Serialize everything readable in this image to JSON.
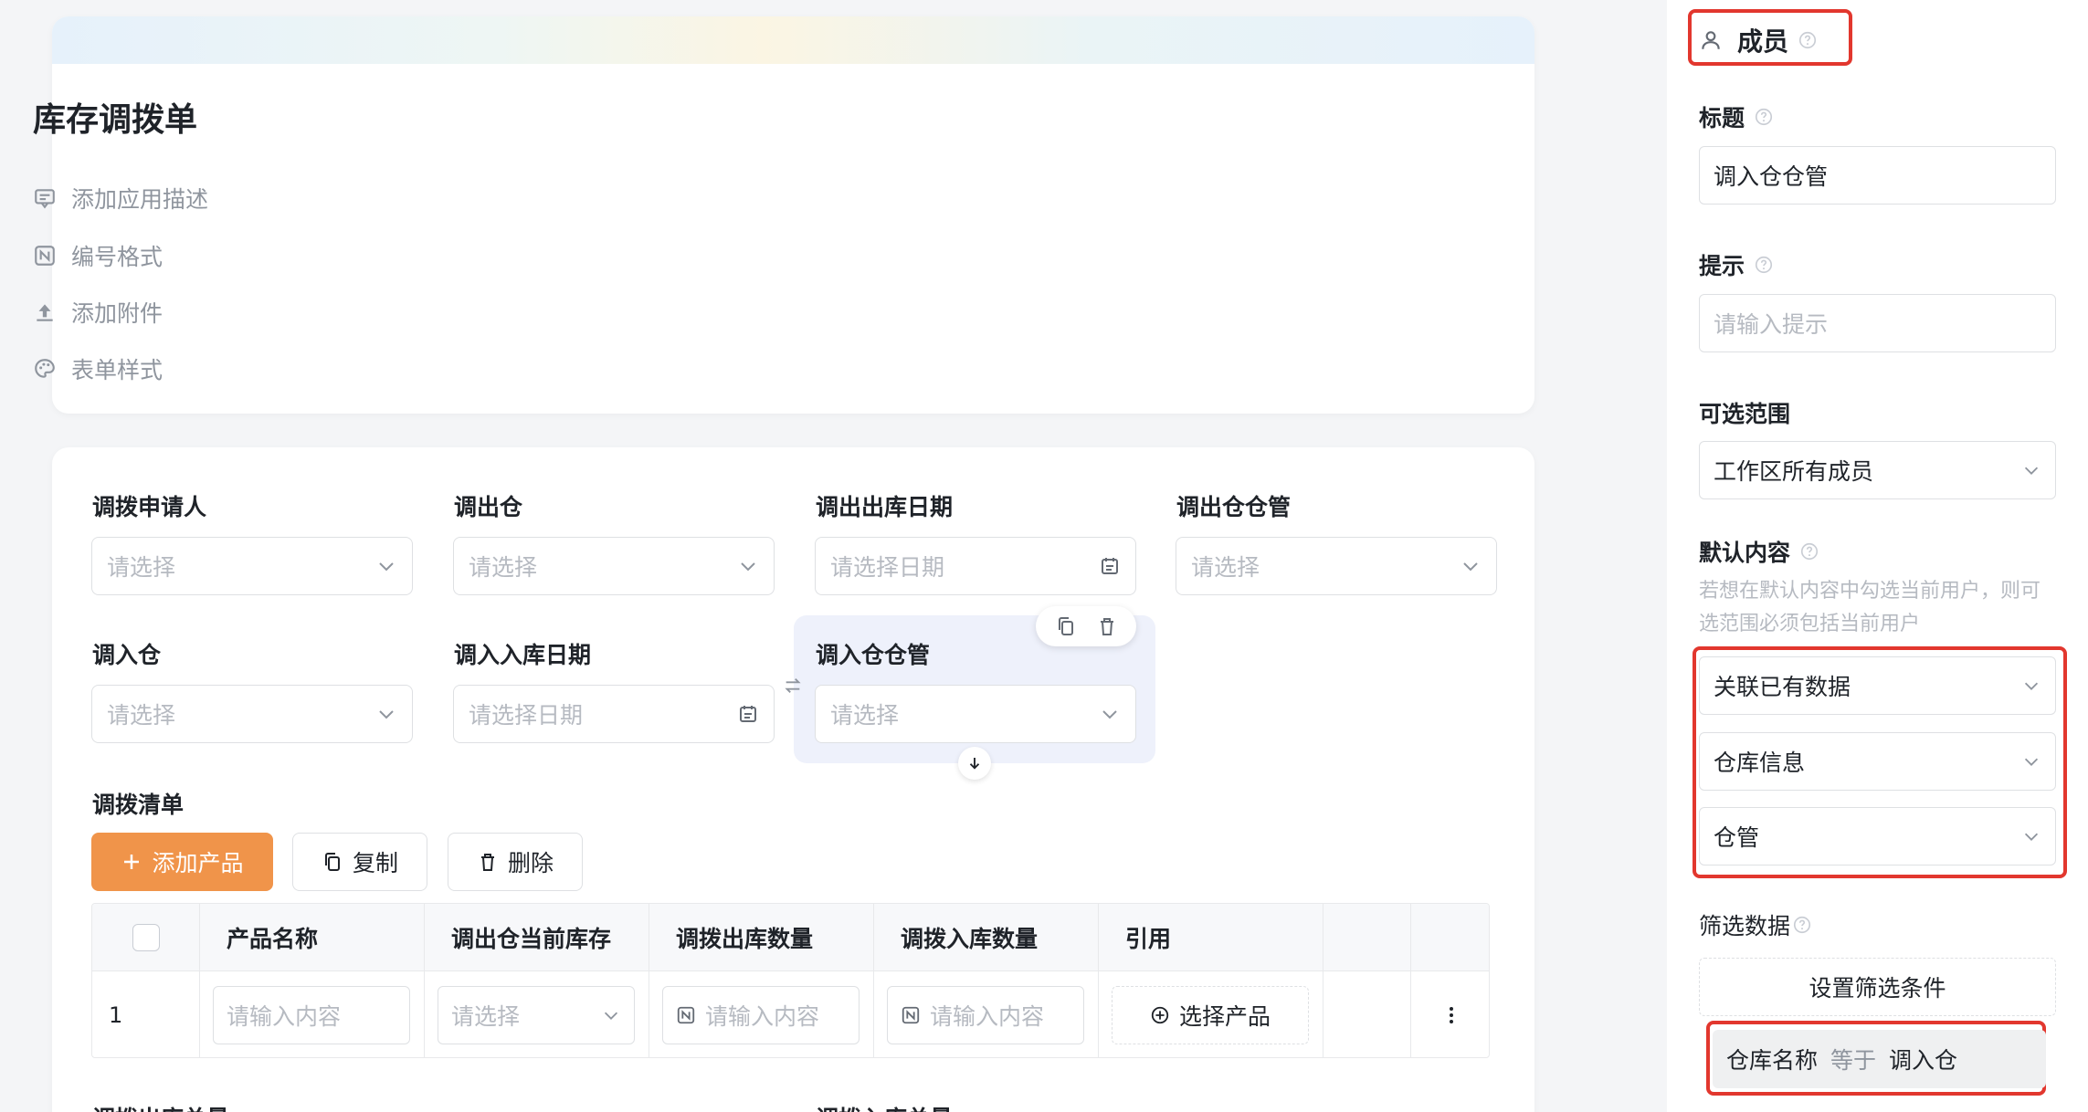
{
  "header": {
    "title": "库存调拨单",
    "meta": [
      {
        "icon": "comment-icon",
        "label": "添加应用描述"
      },
      {
        "icon": "number-format-icon",
        "label": "编号格式"
      },
      {
        "icon": "upload-icon",
        "label": "添加附件"
      },
      {
        "icon": "palette-icon",
        "label": "表单样式"
      }
    ]
  },
  "form": {
    "fields": [
      {
        "label": "调拨申请人",
        "placeholder": "请选择",
        "type": "select"
      },
      {
        "label": "调出仓",
        "placeholder": "请选择",
        "type": "select"
      },
      {
        "label": "调出出库日期",
        "placeholder": "请选择日期",
        "type": "date"
      },
      {
        "label": "调出仓仓管",
        "placeholder": "请选择",
        "type": "select"
      },
      {
        "label": "调入仓",
        "placeholder": "请选择",
        "type": "select"
      },
      {
        "label": "调入入库日期",
        "placeholder": "请选择日期",
        "type": "date"
      },
      {
        "label": "调入仓仓管",
        "placeholder": "请选择",
        "type": "select",
        "selected": true
      }
    ],
    "list_section": {
      "label": "调拨清单",
      "buttons": {
        "add": "添加产品",
        "copy": "复制",
        "delete": "删除"
      },
      "columns": [
        "产品名称",
        "调出仓当前库存",
        "调拨出库数量",
        "调拨入库数量",
        "引用"
      ],
      "rows": [
        {
          "index": "1",
          "product_placeholder": "请输入内容",
          "stock_placeholder": "请选择",
          "out_qty_placeholder": "请输入内容",
          "in_qty_placeholder": "请输入内容",
          "ref_button": "选择产品"
        }
      ]
    },
    "bottom_labels": [
      "调拨出库总量",
      "调拨入库总量"
    ]
  },
  "panel": {
    "title": "成员",
    "title_field": {
      "label": "标题",
      "value": "调入仓仓管"
    },
    "hint_field": {
      "label": "提示",
      "placeholder": "请输入提示"
    },
    "range_field": {
      "label": "可选范围",
      "value": "工作区所有成员"
    },
    "default_field": {
      "label": "默认内容",
      "note": "若想在默认内容中勾选当前用户，则可选范围必须包括当前用户",
      "selects": [
        "关联已有数据",
        "仓库信息",
        "仓管"
      ]
    },
    "filter_field": {
      "label": "筛选数据",
      "button": "设置筛选条件",
      "condition": {
        "field": "仓库名称",
        "operator": "等于",
        "value": "调入仓"
      }
    }
  },
  "colors": {
    "accent": "#f0944a",
    "highlight_border": "#e2372e",
    "selected_bg": "#eef1fb"
  }
}
